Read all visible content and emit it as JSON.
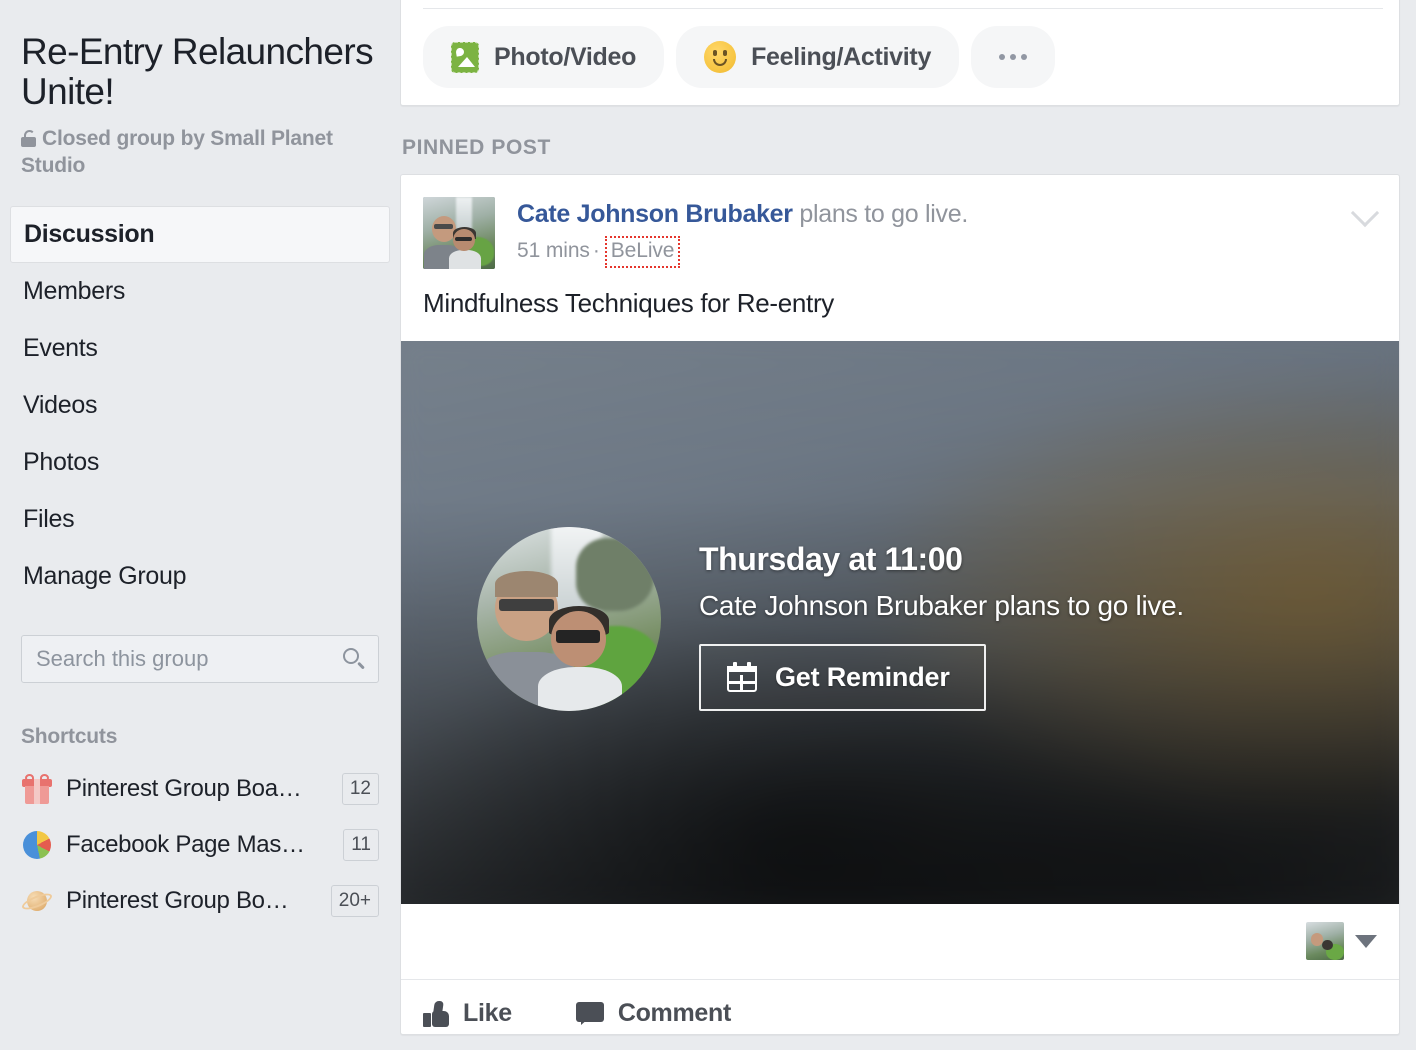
{
  "sidebar": {
    "group_title": "Re-Entry Relaunchers Unite!",
    "group_subtitle": "Closed group by Small Planet Studio",
    "lock_icon": "open-lock-icon",
    "nav": [
      {
        "label": "Discussion",
        "active": true
      },
      {
        "label": "Members",
        "active": false
      },
      {
        "label": "Events",
        "active": false
      },
      {
        "label": "Videos",
        "active": false
      },
      {
        "label": "Photos",
        "active": false
      },
      {
        "label": "Files",
        "active": false
      },
      {
        "label": "Manage Group",
        "active": false
      }
    ],
    "search": {
      "placeholder": "Search this group",
      "value": "",
      "icon": "search-icon"
    },
    "shortcuts_heading": "Shortcuts",
    "shortcuts": [
      {
        "label": "Pinterest Group Boa…",
        "badge": "12",
        "icon": "gift-box-icon"
      },
      {
        "label": "Facebook Page Mas…",
        "badge": "11",
        "icon": "pie-chart-icon"
      },
      {
        "label": "Pinterest Group Bo…",
        "badge": "20+",
        "icon": "planet-icon"
      }
    ]
  },
  "composer": {
    "actions": [
      {
        "label": "Photo/Video",
        "icon": "photo-video-icon"
      },
      {
        "label": "Feeling/Activity",
        "icon": "smiley-face-icon"
      }
    ],
    "more_icon": "ellipsis-icon"
  },
  "feed": {
    "pinned_label": "PINNED POST"
  },
  "post": {
    "author": "Cate Johnson Brubaker",
    "byline_suffix": " plans to go live.",
    "timestamp": "51 mins",
    "separator": "·",
    "source": "BeLive",
    "source_highlight_color": "#e5362d",
    "avatar_icon": "author-avatar",
    "menu_icon": "chevron-down-icon",
    "message": "Mindfulness Techniques for Re-entry",
    "live_card": {
      "when": "Thursday at 11:00",
      "who": "Cate Johnson Brubaker plans to go live.",
      "reminder_label": "Get Reminder",
      "reminder_icon": "calendar-icon",
      "avatar_icon": "live-author-avatar"
    },
    "reactions": {
      "viewer_avatar_icon": "viewer-avatar",
      "caret_icon": "caret-down-icon"
    },
    "actions": [
      {
        "label": "Like",
        "icon": "thumbs-up-icon"
      },
      {
        "label": "Comment",
        "icon": "comment-bubble-icon"
      }
    ]
  },
  "colors": {
    "page_background": "#e9ebee",
    "card_background": "#ffffff",
    "card_border": "#dddfe2",
    "primary_text": "#1d2129",
    "muted_text": "#90949c",
    "link_blue": "#365899",
    "action_text": "#4b4f56",
    "photo_icon_green": "#7cb342",
    "smiley_yellow": "#f7c644"
  }
}
